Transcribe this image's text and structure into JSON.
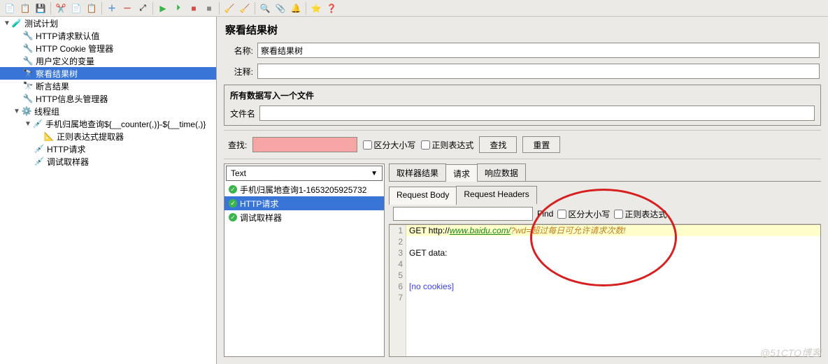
{
  "toolbar_icons": [
    "file",
    "template",
    "save",
    "run",
    "clear",
    "clipboard",
    "script",
    "plus",
    "minus",
    "collapse",
    "play",
    "play2",
    "stop",
    "stop2",
    "clean",
    "clean2",
    "binoc",
    "clip",
    "sound",
    "star",
    "help"
  ],
  "tree": {
    "root": "测试计划",
    "items": [
      "HTTP请求默认值",
      "HTTP Cookie 管理器",
      "用户定义的变量",
      "察看结果树",
      "断言结果",
      "HTTP信息头管理器"
    ],
    "thread_group": "线程组",
    "sampler": "手机归属地查询${__counter(,)}-${__time(,)}",
    "sampler_children": [
      "正则表达式提取器"
    ],
    "other_samplers": [
      "HTTP请求",
      "调试取样器"
    ]
  },
  "panel": {
    "title": "察看结果树",
    "name_label": "名称:",
    "name_value": "察看结果树",
    "comment_label": "注释:",
    "file_section": "所有数据写入一个文件",
    "file_label": "文件名",
    "search_label": "查找:",
    "case_label": "区分大小写",
    "regex_label": "正则表达式",
    "search_btn": "查找",
    "reset_btn": "重置"
  },
  "samples": {
    "selector": "Text",
    "rows": [
      {
        "name": "手机归属地查询1-1653205925732",
        "sel": false
      },
      {
        "name": "HTTP请求",
        "sel": true
      },
      {
        "name": "调试取样器",
        "sel": false
      }
    ]
  },
  "detail": {
    "tabs": [
      "取样器结果",
      "请求",
      "响应数据"
    ],
    "active_tab": 1,
    "sub_tabs": [
      "Request Body",
      "Request Headers"
    ],
    "active_sub": 0,
    "find_label": "Find",
    "find_case": "区分大小写",
    "find_regex": "正则表达式"
  },
  "code": {
    "lines": [
      {
        "n": 1,
        "pre": "GET http://",
        "url": "www.baidu.com/",
        "mid": "?wd=",
        "param": "超过每日可允许请求次数!",
        "hl": true
      },
      {
        "n": 2,
        "text": ""
      },
      {
        "n": 3,
        "text": "GET data:"
      },
      {
        "n": 4,
        "text": ""
      },
      {
        "n": 5,
        "text": ""
      },
      {
        "n": 6,
        "cookies": "[no cookies]"
      },
      {
        "n": 7,
        "text": ""
      }
    ]
  },
  "watermark": "@51CTO博客"
}
